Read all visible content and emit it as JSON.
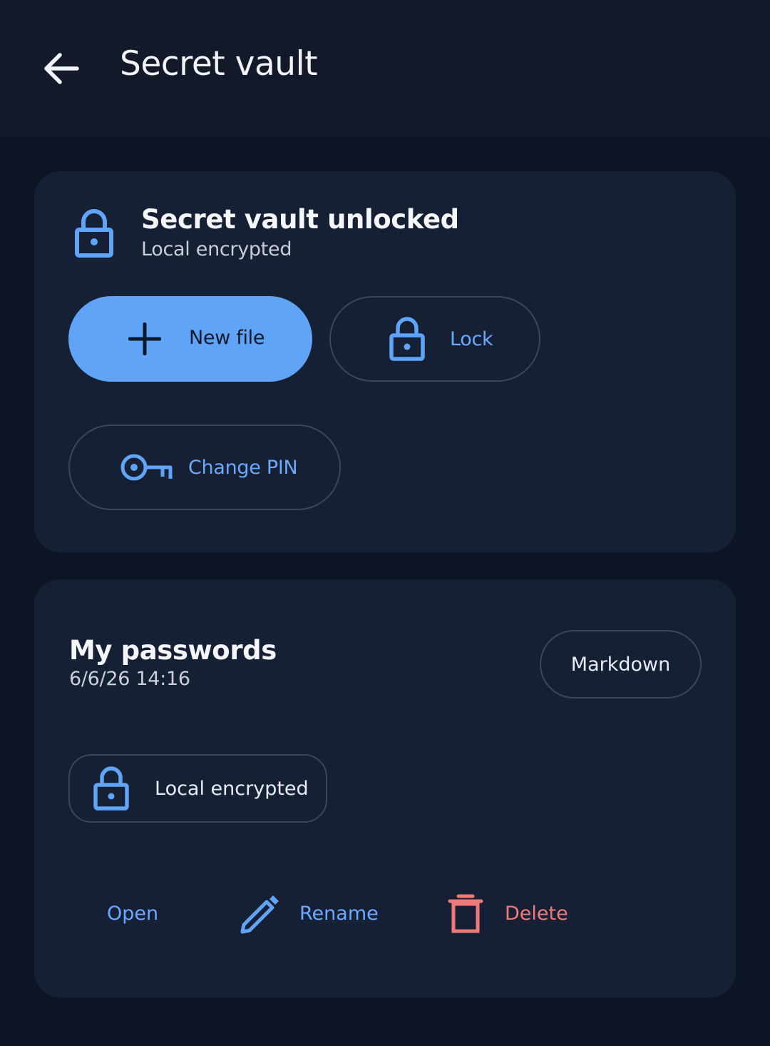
{
  "appbar": {
    "title": "Secret vault",
    "back_icon": "arrow-left-icon"
  },
  "vault": {
    "status_title": "Secret vault unlocked",
    "status_subtitle": "Local encrypted",
    "status_icon": "lock-icon",
    "buttons": {
      "new_file": "New file",
      "lock": "Lock",
      "change_pin": "Change PIN"
    }
  },
  "file": {
    "name": "My passwords",
    "date": "6/6/26 14:16",
    "format": "Markdown",
    "encryption": "Local encrypted",
    "actions": {
      "open": "Open",
      "rename": "Rename",
      "delete": "Delete"
    }
  },
  "colors": {
    "background": "#0d1424",
    "appbar": "#121a2a",
    "card": "#162034",
    "accent": "#5fa4f7",
    "accent_text": "#6ba9ff",
    "danger": "#f07a7a"
  }
}
